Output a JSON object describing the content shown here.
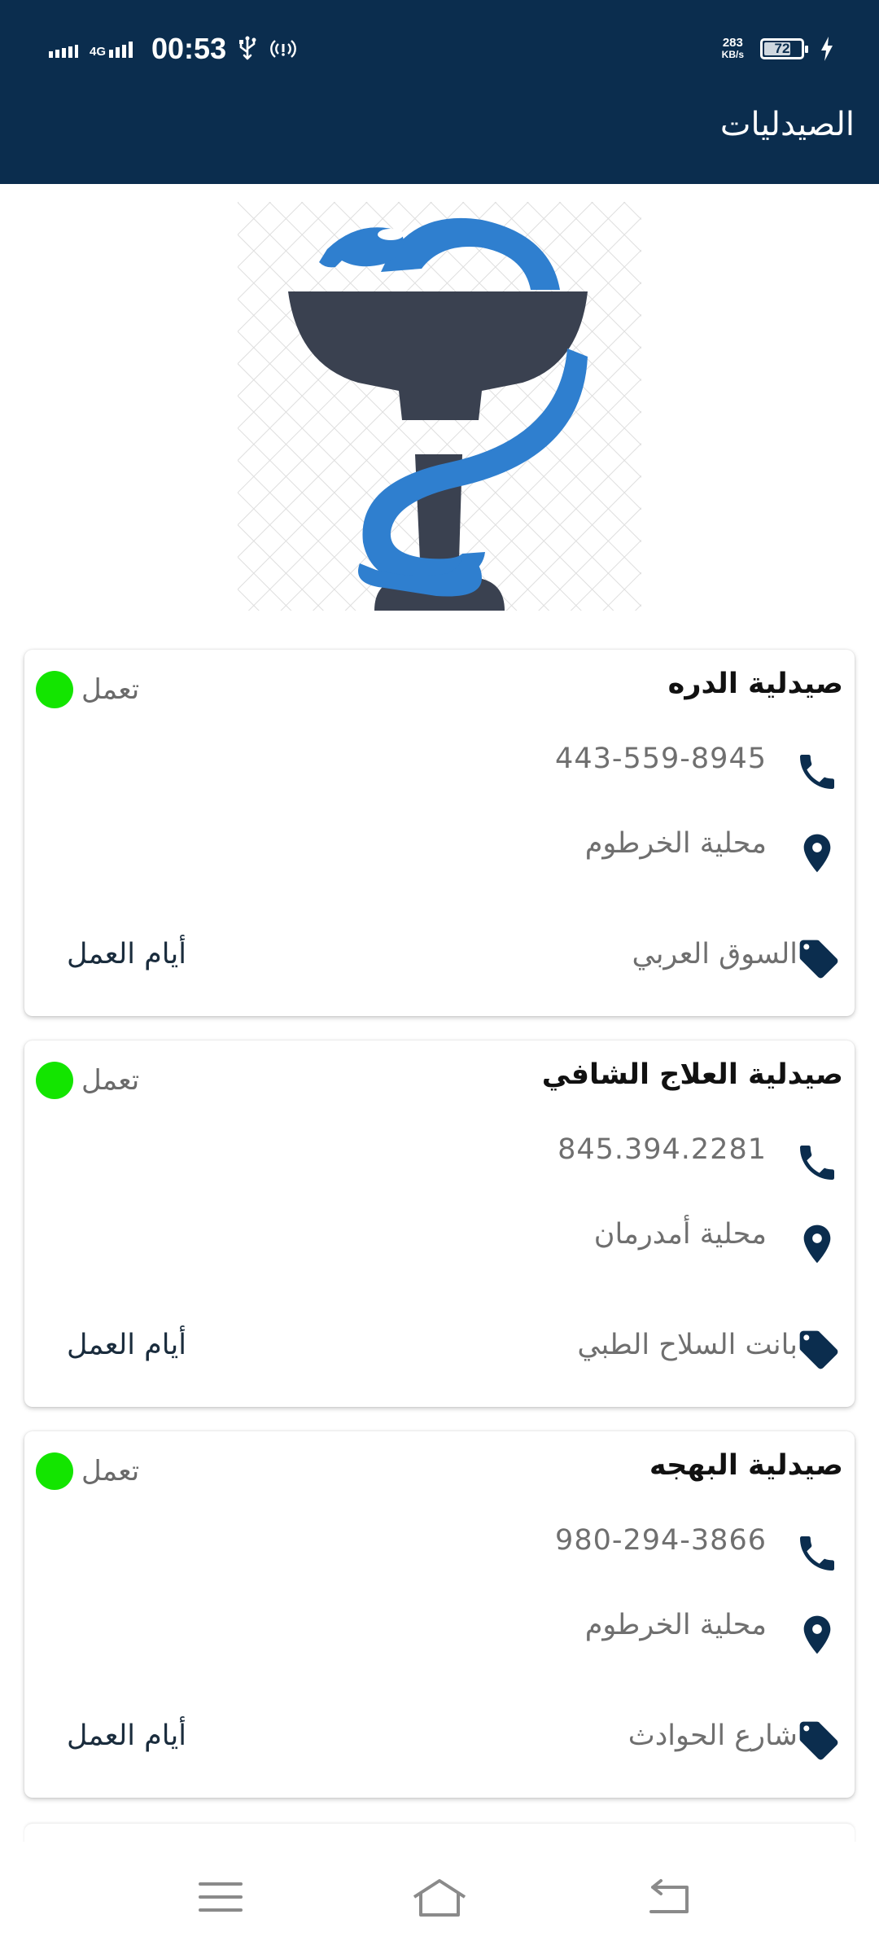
{
  "status_bar": {
    "time": "00:53",
    "network_type": "4G",
    "speed_value": "283",
    "speed_unit": "KB/s",
    "battery_level": "72",
    "battery_fraction": 0.72
  },
  "app_bar": {
    "title": "الصيدليات"
  },
  "colors": {
    "primary": "#0b2d4e",
    "status_open": "#13e500",
    "logo_blue": "#2f7fcf",
    "logo_dark": "#3a4150"
  },
  "pharmacies": [
    {
      "name": "صيدلية الدره",
      "status": "تعمل",
      "phone": "443-559-8945",
      "locality": "محلية الخرطوم",
      "street": "السوق العربي",
      "work_days_label": "أيام العمل"
    },
    {
      "name": "صيدلية العلاج الشافي",
      "status": "تعمل",
      "phone": "845.394.2281",
      "locality": "محلية أمدرمان",
      "street": "بانت السلاح الطبي",
      "work_days_label": "أيام العمل"
    },
    {
      "name": "صيدلية البهجه",
      "status": "تعمل",
      "phone": "980-294-3866",
      "locality": "محلية الخرطوم",
      "street": "شارع الحوادث",
      "work_days_label": "أيام العمل"
    }
  ],
  "icons": {
    "phone": "phone-icon",
    "location": "location-pin-icon",
    "tag": "tag-icon",
    "menu": "menu-icon",
    "home": "home-icon",
    "back": "back-icon"
  }
}
